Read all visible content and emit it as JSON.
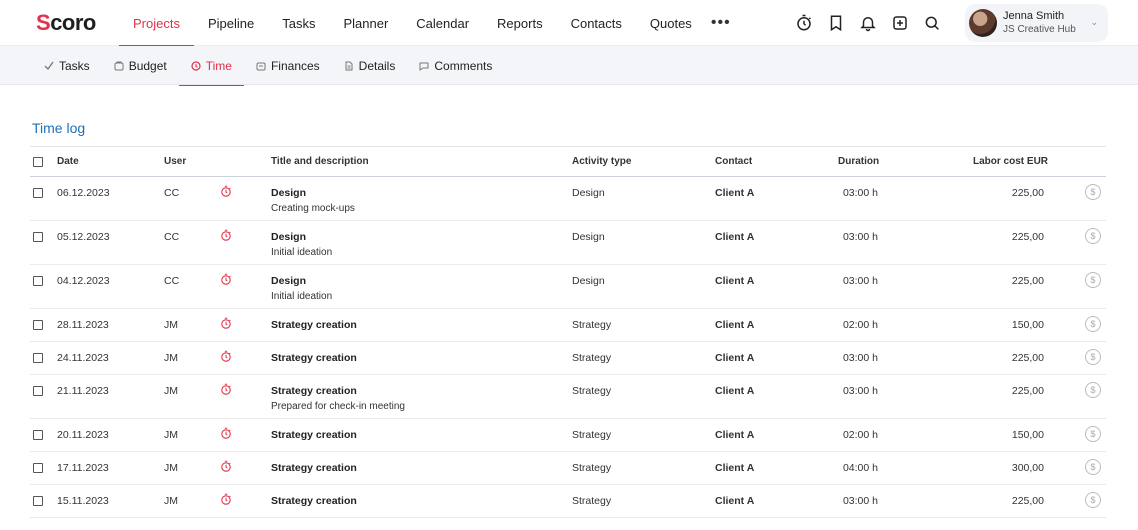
{
  "brand": {
    "name_rest": "coro",
    "name_first": "S",
    "accent": "#e2314a",
    "link_blue": "#1f6fb5"
  },
  "nav": {
    "items": [
      {
        "label": "Projects",
        "active": true
      },
      {
        "label": "Pipeline",
        "active": false
      },
      {
        "label": "Tasks",
        "active": false
      },
      {
        "label": "Planner",
        "active": false
      },
      {
        "label": "Calendar",
        "active": false
      },
      {
        "label": "Reports",
        "active": false
      },
      {
        "label": "Contacts",
        "active": false
      },
      {
        "label": "Quotes",
        "active": false
      }
    ],
    "more_label": "•••"
  },
  "top_icons": [
    "stopwatch-icon",
    "bookmark-icon",
    "bell-icon",
    "add-square-icon",
    "search-icon"
  ],
  "user": {
    "name": "Jenna Smith",
    "org": "JS Creative Hub",
    "chevron": "⌄"
  },
  "subnav": {
    "items": [
      {
        "label": "Tasks",
        "icon": "check-icon",
        "active": false
      },
      {
        "label": "Budget",
        "icon": "budget-icon",
        "active": false
      },
      {
        "label": "Time",
        "icon": "clock-icon",
        "active": true
      },
      {
        "label": "Finances",
        "icon": "finances-icon",
        "active": false
      },
      {
        "label": "Details",
        "icon": "document-icon",
        "active": false
      },
      {
        "label": "Comments",
        "icon": "comment-icon",
        "active": false
      }
    ]
  },
  "section": {
    "title": "Time log"
  },
  "table": {
    "headers": {
      "date": "Date",
      "user": "User",
      "title": "Title and description",
      "activity": "Activity type",
      "contact": "Contact",
      "duration": "Duration",
      "labor": "Labor cost EUR"
    },
    "money_symbol": "$",
    "rows": [
      {
        "date": "06.12.2023",
        "user": "CC",
        "title": "Design",
        "desc": "Creating mock-ups",
        "activity": "Design",
        "contact": "Client A",
        "duration": "03:00 h",
        "labor": "225,00"
      },
      {
        "date": "05.12.2023",
        "user": "CC",
        "title": "Design",
        "desc": "Initial ideation",
        "activity": "Design",
        "contact": "Client A",
        "duration": "03:00 h",
        "labor": "225,00"
      },
      {
        "date": "04.12.2023",
        "user": "CC",
        "title": "Design",
        "desc": "Initial ideation",
        "activity": "Design",
        "contact": "Client A",
        "duration": "03:00 h",
        "labor": "225,00"
      },
      {
        "date": "28.11.2023",
        "user": "JM",
        "title": "Strategy creation",
        "desc": "",
        "activity": "Strategy",
        "contact": "Client A",
        "duration": "02:00 h",
        "labor": "150,00"
      },
      {
        "date": "24.11.2023",
        "user": "JM",
        "title": "Strategy creation",
        "desc": "",
        "activity": "Strategy",
        "contact": "Client A",
        "duration": "03:00 h",
        "labor": "225,00"
      },
      {
        "date": "21.11.2023",
        "user": "JM",
        "title": "Strategy creation",
        "desc": "Prepared for check-in meeting",
        "activity": "Strategy",
        "contact": "Client A",
        "duration": "03:00 h",
        "labor": "225,00"
      },
      {
        "date": "20.11.2023",
        "user": "JM",
        "title": "Strategy creation",
        "desc": "",
        "activity": "Strategy",
        "contact": "Client A",
        "duration": "02:00 h",
        "labor": "150,00"
      },
      {
        "date": "17.11.2023",
        "user": "JM",
        "title": "Strategy creation",
        "desc": "",
        "activity": "Strategy",
        "contact": "Client A",
        "duration": "04:00 h",
        "labor": "300,00"
      },
      {
        "date": "15.11.2023",
        "user": "JM",
        "title": "Strategy creation",
        "desc": "",
        "activity": "Strategy",
        "contact": "Client A",
        "duration": "03:00 h",
        "labor": "225,00"
      }
    ]
  }
}
